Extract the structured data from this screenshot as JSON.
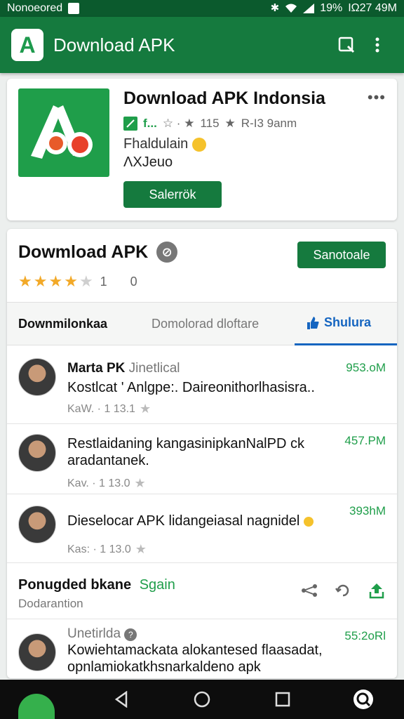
{
  "status_bar": {
    "carrier": "Nonoeored",
    "battery": "19%",
    "time": "ΙΩ27 49M"
  },
  "app_bar": {
    "title": "Download APK",
    "logo_letter": "A"
  },
  "app_card": {
    "title": "Download APK Indonsia",
    "publisher": "f...",
    "rating_count": "115",
    "downloads": "R-I3 9anm",
    "subtitle": "Fhaldulain",
    "version": "ΛΧJeuo",
    "install_label": "Salerrök"
  },
  "main_card": {
    "title": "Dowmload APK",
    "action_label": "Sanotoale",
    "rating": 4,
    "rating_text": "1 0"
  },
  "tabs": [
    {
      "label": "Downmilonkaa"
    },
    {
      "label": "Domolorad dloftare"
    },
    {
      "label": "Shulura"
    }
  ],
  "reviews": [
    {
      "name": "Marta PK",
      "name_extra": "Jinetlical",
      "text": "Kostlcat ' Anlgpe:. Daireonithorlhasisra..",
      "meta": "KaW. · 1 13.1",
      "time": "953.oM"
    },
    {
      "name": "",
      "name_extra": "",
      "text": "Restlaidaning kangasinipkanNalPD ck aradantanek.",
      "meta": "Kav. · 1 13.0",
      "time": "457.PM"
    },
    {
      "name": "",
      "name_extra": "",
      "text": "Dieselocar APK lidangeiasal nagnidel",
      "meta": "Kas: · 1 13.0",
      "time": "393hM"
    }
  ],
  "section": {
    "title": "Ponugded bkane",
    "link": "Sgain",
    "subtitle": "Dodarantion"
  },
  "last_review": {
    "name": "Unetirlda",
    "text": "Kowiehtamackata alokantesed flaasadat, opnlamiokatkhsnarkaldeno apk",
    "time": "55:2oRl"
  },
  "colors": {
    "primary": "#157a3e",
    "accent_green": "#1f9e4a",
    "tab_active": "#1565c0",
    "star": "#f2a928"
  },
  "icons": {
    "app_bar": [
      "search-icon",
      "more-vert-icon"
    ],
    "nav": [
      "back-icon",
      "home-icon",
      "recents-icon",
      "assistant-icon"
    ]
  }
}
